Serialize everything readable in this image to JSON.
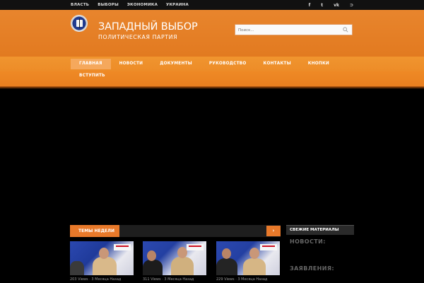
{
  "topnav": [
    "ВЛАСТЬ",
    "ВЫБОРЫ",
    "ЭКОНОМИКА",
    "УКРАИНА"
  ],
  "social": [
    {
      "icon": "facebook-icon",
      "glyph": "f"
    },
    {
      "icon": "twitter-icon",
      "glyph": "t"
    },
    {
      "icon": "vk-icon",
      "glyph": "vk"
    },
    {
      "icon": "rss-icon",
      "glyph": "⊃"
    }
  ],
  "site": {
    "title": "ЗАПАДНЫЙ ВЫБОР",
    "subtitle": "ПОЛИТИЧЕСКАЯ ПАРТИЯ"
  },
  "search": {
    "placeholder": "Поиск..."
  },
  "menu": {
    "row1": [
      {
        "label": "ГЛАВНАЯ",
        "active": true
      },
      {
        "label": "НОВОСТИ"
      },
      {
        "label": "ДОКУМЕНТЫ"
      },
      {
        "label": "РУКОВОДСТВО"
      },
      {
        "label": "КОНТАКТЫ"
      },
      {
        "label": "КНОПКИ"
      }
    ],
    "row2": [
      {
        "label": "ВСТУПИТЬ"
      }
    ]
  },
  "widget": {
    "title": "ТЕМЫ НЕДЕЛИ",
    "arrow": "›"
  },
  "posts": [
    {
      "meta": "203 Views · 3 Месяца Назад"
    },
    {
      "meta": "311 Views · 3 Месяца Назад"
    },
    {
      "meta": "229 Views · 3 Месяца Назад"
    }
  ],
  "sidebar": {
    "heading": "СВЕЖИЕ МАТЕРИАЛЫ",
    "categories": [
      "НОВОСТИ:",
      "ЗАЯВЛЕНИЯ:"
    ]
  },
  "colors": {
    "accent": "#e8792a",
    "header": "#e27a20",
    "background": "#000000"
  }
}
